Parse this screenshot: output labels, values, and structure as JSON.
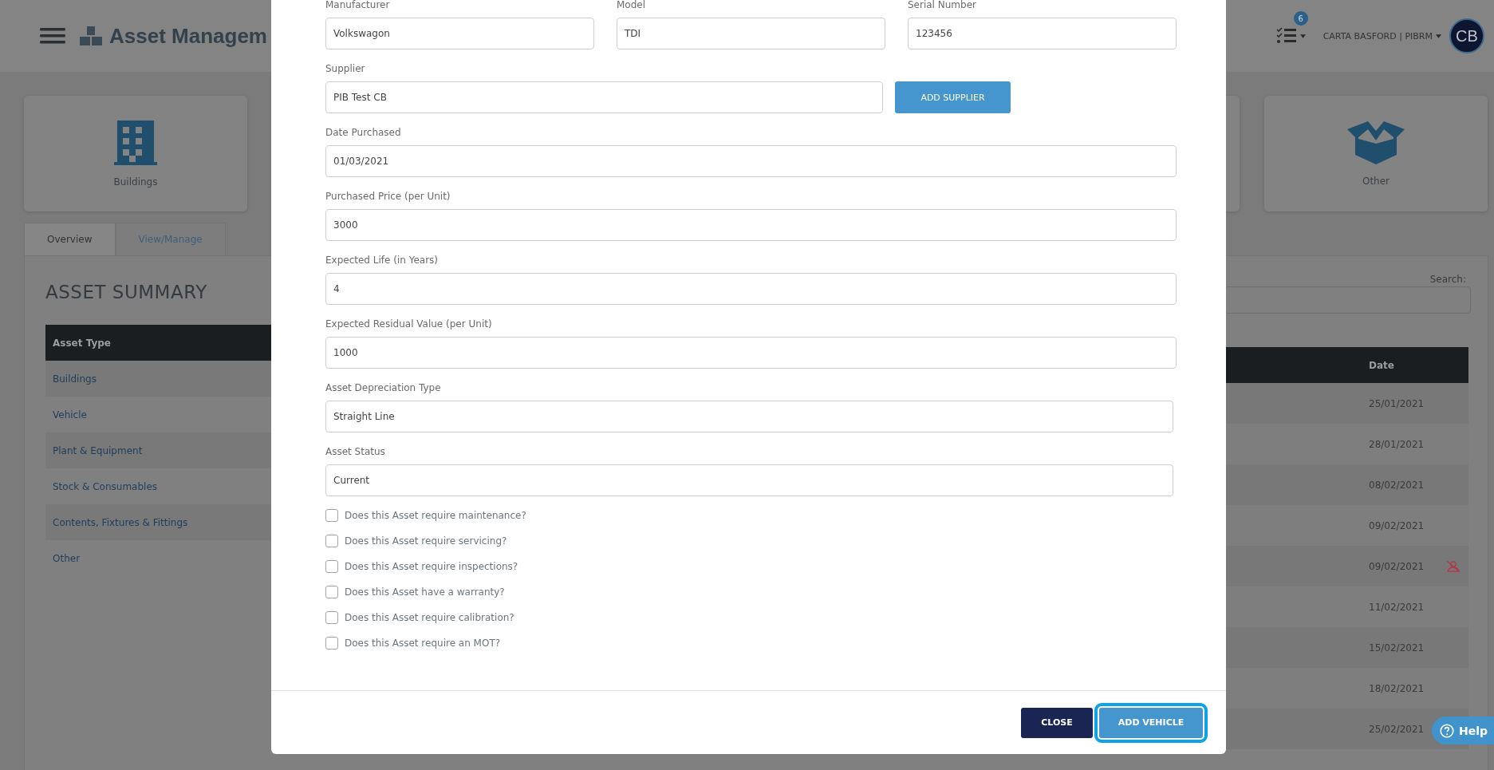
{
  "header": {
    "title": "Asset Managem",
    "task_badge": "6",
    "user": "CARTA BASFORD | PIBRM",
    "avatar": "CB"
  },
  "category_cards": [
    {
      "label": "Buildings",
      "kind": "building"
    },
    {
      "label": "Other",
      "kind": "box"
    }
  ],
  "tabs": [
    {
      "label": "Overview",
      "selected": true
    },
    {
      "label": "View/Manage",
      "selected": false
    }
  ],
  "asset_summary": {
    "title": "ASSET SUMMARY",
    "columns": [
      "Asset Type"
    ],
    "rows": [
      "Buildings",
      "Vehicle",
      "Plant & Equipment",
      "Stock & Consumables",
      "Contents, Fixtures & Fittings",
      "Other"
    ]
  },
  "search": {
    "label": "Search:"
  },
  "records_table": {
    "columns": [
      "Date"
    ],
    "rows": [
      {
        "date": "25/01/2021",
        "flagged": false
      },
      {
        "date": "28/01/2021",
        "flagged": false
      },
      {
        "date": "08/02/2021",
        "flagged": false
      },
      {
        "date": "09/02/2021",
        "flagged": false
      },
      {
        "date": "09/02/2021",
        "flagged": true
      },
      {
        "date": "11/02/2021",
        "flagged": false
      },
      {
        "date": "15/02/2021",
        "flagged": false
      },
      {
        "date": "18/02/2021",
        "flagged": false
      },
      {
        "date": "25/02/2021",
        "flagged": false
      }
    ]
  },
  "modal": {
    "top_fields": [
      {
        "label": "Manufacturer",
        "value": "Volkswagon"
      },
      {
        "label": "Model",
        "value": "TDI"
      },
      {
        "label": "Serial Number",
        "value": "123456"
      }
    ],
    "supplier": {
      "label": "Supplier",
      "value": "PIB Test CB",
      "button": "ADD SUPPLIER"
    },
    "fields": [
      {
        "label": "Date Purchased",
        "value": "01/03/2021",
        "kind": "text"
      },
      {
        "label": "Purchased Price (per Unit)",
        "value": "3000",
        "kind": "text"
      },
      {
        "label": "Expected Life (in Years)",
        "value": "4",
        "kind": "text"
      },
      {
        "label": "Expected Residual Value (per Unit)",
        "value": "1000",
        "kind": "text"
      },
      {
        "label": "Asset Depreciation Type",
        "value": "Straight Line",
        "kind": "select"
      },
      {
        "label": "Asset Status",
        "value": "Current",
        "kind": "select"
      }
    ],
    "checkboxes": [
      {
        "label": "Does this Asset require maintenance?",
        "checked": false
      },
      {
        "label": "Does this Asset require servicing?",
        "checked": false
      },
      {
        "label": "Does this Asset require inspections?",
        "checked": false
      },
      {
        "label": "Does this Asset have a warranty?",
        "checked": false
      },
      {
        "label": "Does this Asset require calibration?",
        "checked": false
      },
      {
        "label": "Does this Asset require an MOT?",
        "checked": false
      }
    ],
    "buttons": [
      {
        "label": "CLOSE",
        "kind": "secondary",
        "focused": false
      },
      {
        "label": "ADD VEHICLE",
        "kind": "primary",
        "focused": true
      }
    ]
  },
  "help": {
    "label": "Help"
  }
}
